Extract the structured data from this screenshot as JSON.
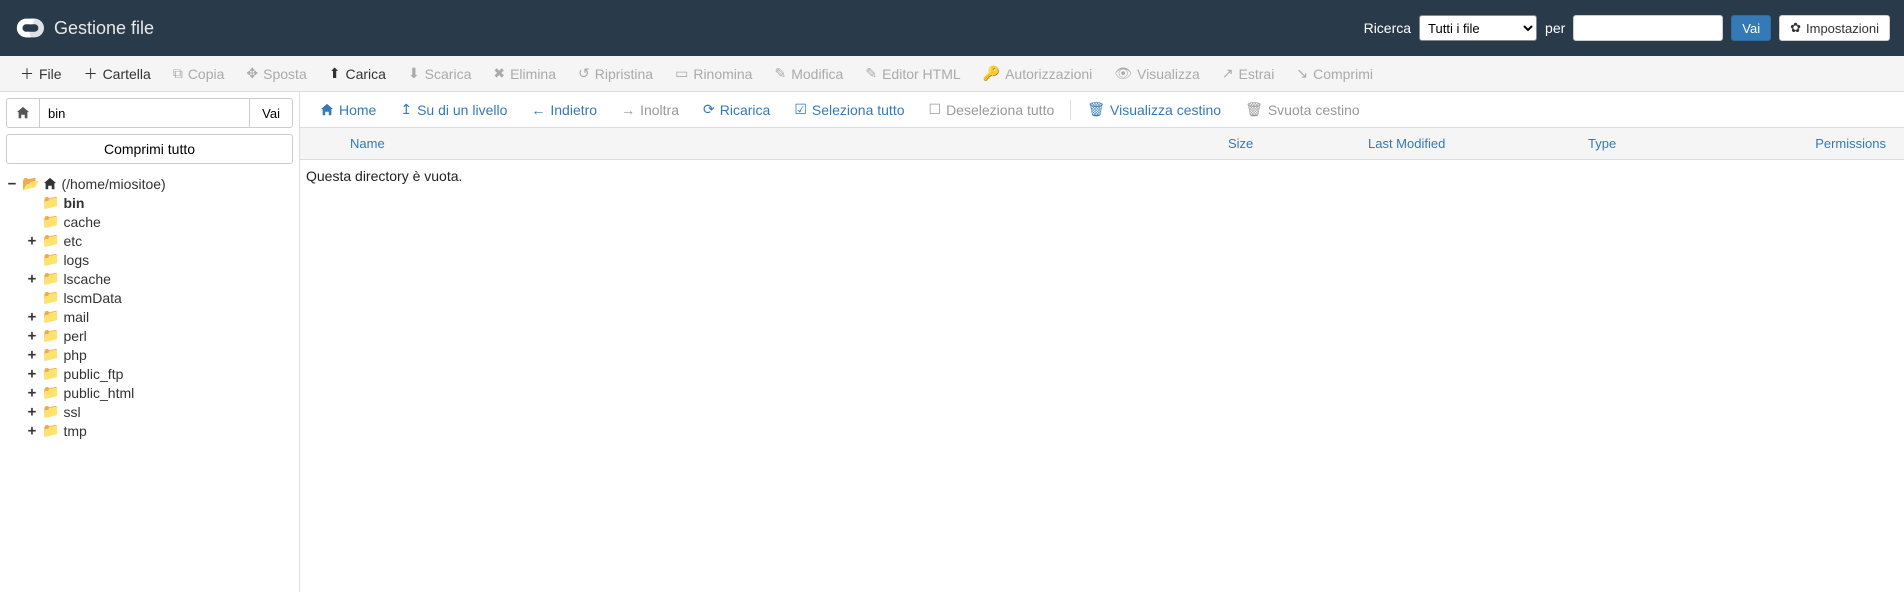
{
  "header": {
    "title": "Gestione file",
    "search_label": "Ricerca",
    "search_scope": "Tutti i file",
    "for_label": "per",
    "go_label": "Vai",
    "settings_label": "Impostazioni"
  },
  "toolbar": {
    "file": "File",
    "folder": "Cartella",
    "copy": "Copia",
    "move": "Sposta",
    "upload": "Carica",
    "download": "Scarica",
    "delete": "Elimina",
    "restore": "Ripristina",
    "rename": "Rinomina",
    "edit": "Modifica",
    "html_editor": "Editor HTML",
    "permissions": "Autorizzazioni",
    "view": "Visualizza",
    "extract": "Estrai",
    "compress": "Comprimi"
  },
  "sidebar": {
    "path_value": "bin",
    "go": "Vai",
    "collapse_all": "Comprimi tutto",
    "root_label": "(/home/miositoe)",
    "tree": [
      {
        "label": "bin",
        "toggle": "",
        "bold": true
      },
      {
        "label": "cache",
        "toggle": ""
      },
      {
        "label": "etc",
        "toggle": "+"
      },
      {
        "label": "logs",
        "toggle": ""
      },
      {
        "label": "lscache",
        "toggle": "+"
      },
      {
        "label": "lscmData",
        "toggle": ""
      },
      {
        "label": "mail",
        "toggle": "+"
      },
      {
        "label": "perl",
        "toggle": "+"
      },
      {
        "label": "php",
        "toggle": "+"
      },
      {
        "label": "public_ftp",
        "toggle": "+"
      },
      {
        "label": "public_html",
        "toggle": "+"
      },
      {
        "label": "ssl",
        "toggle": "+"
      },
      {
        "label": "tmp",
        "toggle": "+"
      }
    ]
  },
  "nav": {
    "home": "Home",
    "up": "Su di un livello",
    "back": "Indietro",
    "forward": "Inoltra",
    "reload": "Ricarica",
    "select_all": "Seleziona tutto",
    "deselect_all": "Deseleziona tutto",
    "view_trash": "Visualizza cestino",
    "empty_trash": "Svuota cestino"
  },
  "table": {
    "name": "Name",
    "size": "Size",
    "modified": "Last Modified",
    "type": "Type",
    "permissions": "Permissions"
  },
  "content": {
    "empty": "Questa directory è vuota."
  }
}
